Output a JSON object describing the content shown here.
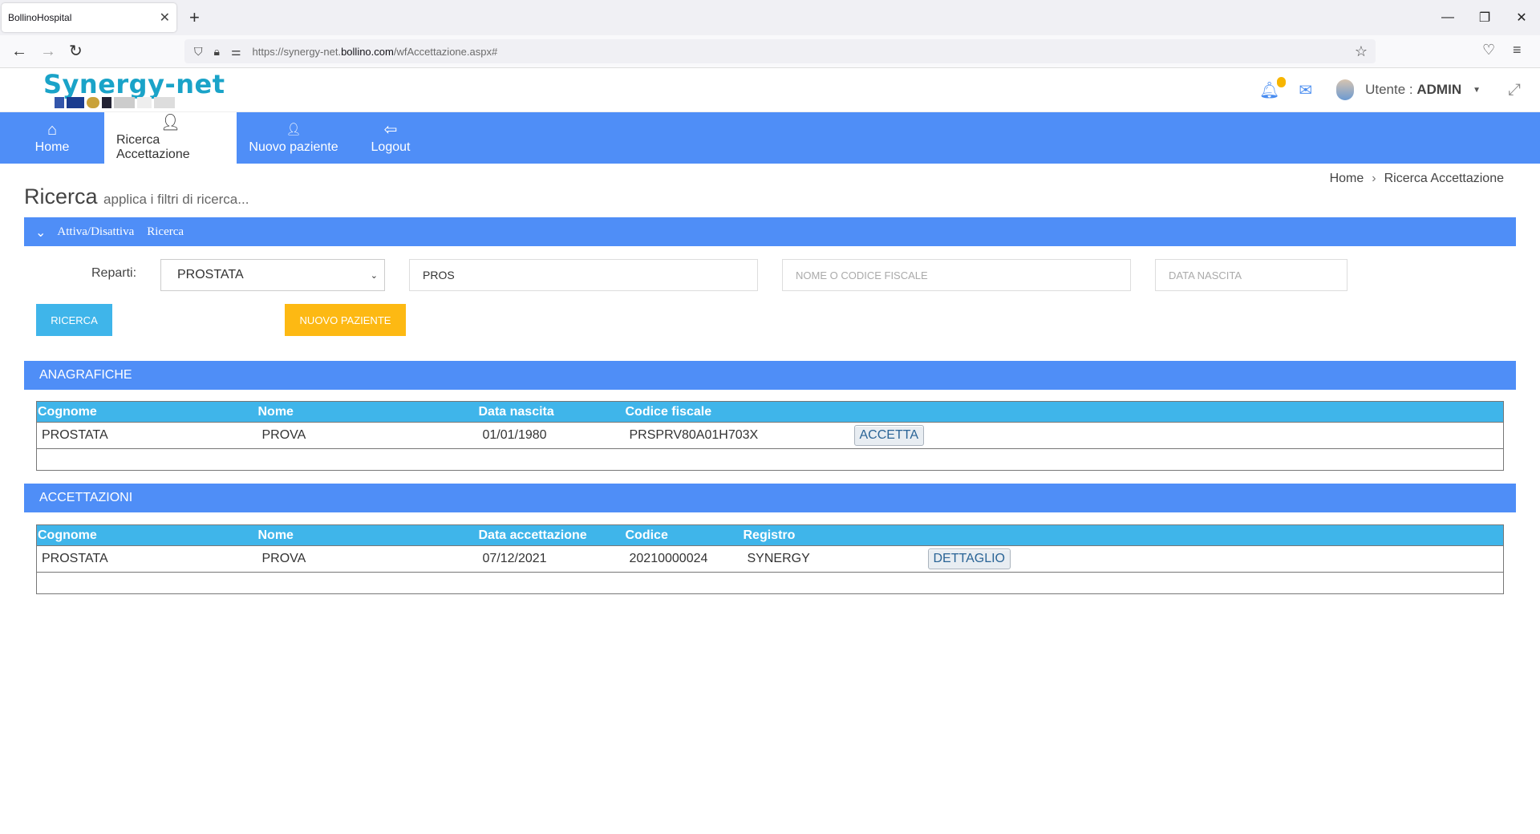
{
  "browser": {
    "tab_title": "BollinoHospital",
    "url_prefix": "https://synergy-net.",
    "url_domain": "bollino.com",
    "url_path": "/wfAccettazione.aspx#"
  },
  "header": {
    "logo_text": "Synergy-net",
    "user_label": "Utente :",
    "user_name": "ADMIN"
  },
  "menu": [
    {
      "label": "Home",
      "icon": "home-icon"
    },
    {
      "label": "Ricerca Accettazione",
      "icon": "user-search-icon"
    },
    {
      "label": "Nuovo paziente",
      "icon": "user-icon"
    },
    {
      "label": "Logout",
      "icon": "logout-icon"
    }
  ],
  "breadcrumb": {
    "home": "Home",
    "current": "Ricerca Accettazione"
  },
  "page": {
    "title": "Ricerca",
    "subtitle": "applica i filtri di ricerca..."
  },
  "filter_bar": {
    "toggle": "Attiva/Disattiva",
    "label": "Ricerca"
  },
  "filters": {
    "reparti_label": "Reparti:",
    "reparti_value": "PROSTATA",
    "search_value": "PROS",
    "name_placeholder": "NOME O CODICE FISCALE",
    "birth_placeholder": "DATA NASCITA"
  },
  "buttons": {
    "search": "RICERCA",
    "new_patient": "NUOVO PAZIENTE"
  },
  "colors": {
    "primary": "#4f8ef7",
    "header_row": "#3fb5ea",
    "search_btn": "#3fb5ea",
    "new_btn": "#fdb913"
  },
  "anagrafiche": {
    "title": "ANAGRAFICHE",
    "headers": [
      "Cognome",
      "Nome",
      "Data nascita",
      "Codice fiscale"
    ],
    "rows": [
      {
        "cognome": "PROSTATA",
        "nome": "PROVA",
        "data": "01/01/1980",
        "codice": "PRSPRV80A01H703X",
        "action": "ACCETTA"
      }
    ]
  },
  "accettazioni": {
    "title": "ACCETTAZIONI",
    "headers": [
      "Cognome",
      "Nome",
      "Data accettazione",
      "Codice",
      "Registro"
    ],
    "rows": [
      {
        "cognome": "PROSTATA",
        "nome": "PROVA",
        "data": "07/12/2021",
        "codice": "20210000024",
        "registro": "SYNERGY",
        "action": "DETTAGLIO"
      }
    ]
  }
}
